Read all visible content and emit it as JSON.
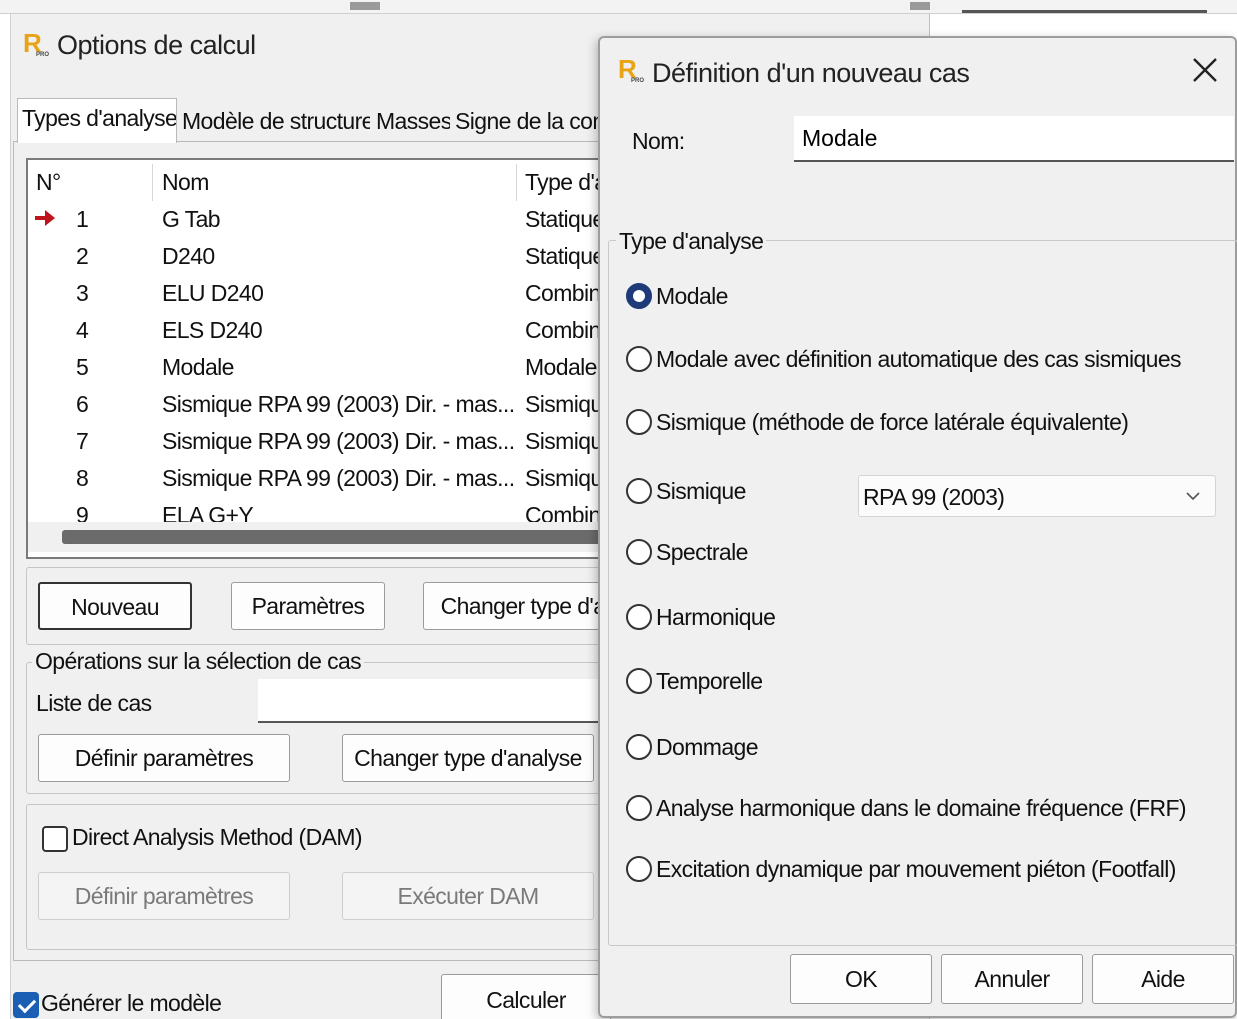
{
  "main_window": {
    "title": "Options de calcul",
    "tabs": [
      "Types d'analyse",
      "Modèle de structure",
      "Masses",
      "Signe de la com"
    ],
    "list": {
      "headers": {
        "num": "N°",
        "name": "Nom",
        "type": "Type d'a"
      },
      "rows": [
        {
          "num": "1",
          "name": "G Tab",
          "type": "Statique",
          "current": true
        },
        {
          "num": "2",
          "name": "D240",
          "type": "Statique"
        },
        {
          "num": "3",
          "name": "ELU D240",
          "type": "Combina"
        },
        {
          "num": "4",
          "name": "ELS D240",
          "type": "Combina"
        },
        {
          "num": "5",
          "name": "Modale",
          "type": "Modale"
        },
        {
          "num": "6",
          "name": "Sismique RPA 99 (2003) Dir. - mas...",
          "type": "Sismique"
        },
        {
          "num": "7",
          "name": "Sismique RPA 99 (2003) Dir. - mas...",
          "type": "Sismique"
        },
        {
          "num": "8",
          "name": "Sismique RPA 99 (2003) Dir. - mas...",
          "type": "Sismique"
        },
        {
          "num": "9",
          "name": "ELA G+Y",
          "type": "Combina"
        }
      ]
    },
    "buttons": {
      "nouveau": "Nouveau",
      "parametres": "Paramètres",
      "changer_type": "Changer type d'a"
    },
    "operations": {
      "title": "Opérations sur la sélection de cas",
      "liste_label": "Liste de cas",
      "liste_value": "",
      "definir": "Définir paramètres",
      "changer": "Changer type d'analyse"
    },
    "dam": {
      "checkbox_label": "Direct Analysis Method (DAM)",
      "checked": false,
      "definir": "Définir paramètres",
      "executer": "Exécuter DAM"
    },
    "generer": {
      "label": "Générer le modèle",
      "checked": true
    },
    "calculer": "Calculer"
  },
  "dialog": {
    "title": "Définition d'un nouveau cas",
    "nom_label": "Nom:",
    "nom_value": "Modale",
    "group_title": "Type d'analyse",
    "options": [
      {
        "label": "Modale",
        "selected": true
      },
      {
        "label": "Modale avec définition automatique des cas sismiques"
      },
      {
        "label": "Sismique (méthode de force latérale équivalente)"
      },
      {
        "label": "Sismique"
      },
      {
        "label": "Spectrale"
      },
      {
        "label": "Harmonique"
      },
      {
        "label": "Temporelle"
      },
      {
        "label": "Dommage"
      },
      {
        "label": "Analyse harmonique dans le domaine fréquence (FRF)"
      },
      {
        "label": "Excitation dynamique par mouvement piéton (Footfall)"
      }
    ],
    "sismique_norm": "RPA 99 (2003)",
    "buttons": {
      "ok": "OK",
      "annuler": "Annuler",
      "aide": "Aide"
    }
  },
  "colors": {
    "radio_selected": "#1e3a78",
    "checkbox_checked": "#1a5fb4",
    "logo": "#e8a317",
    "row_marker": "#c0141c"
  }
}
